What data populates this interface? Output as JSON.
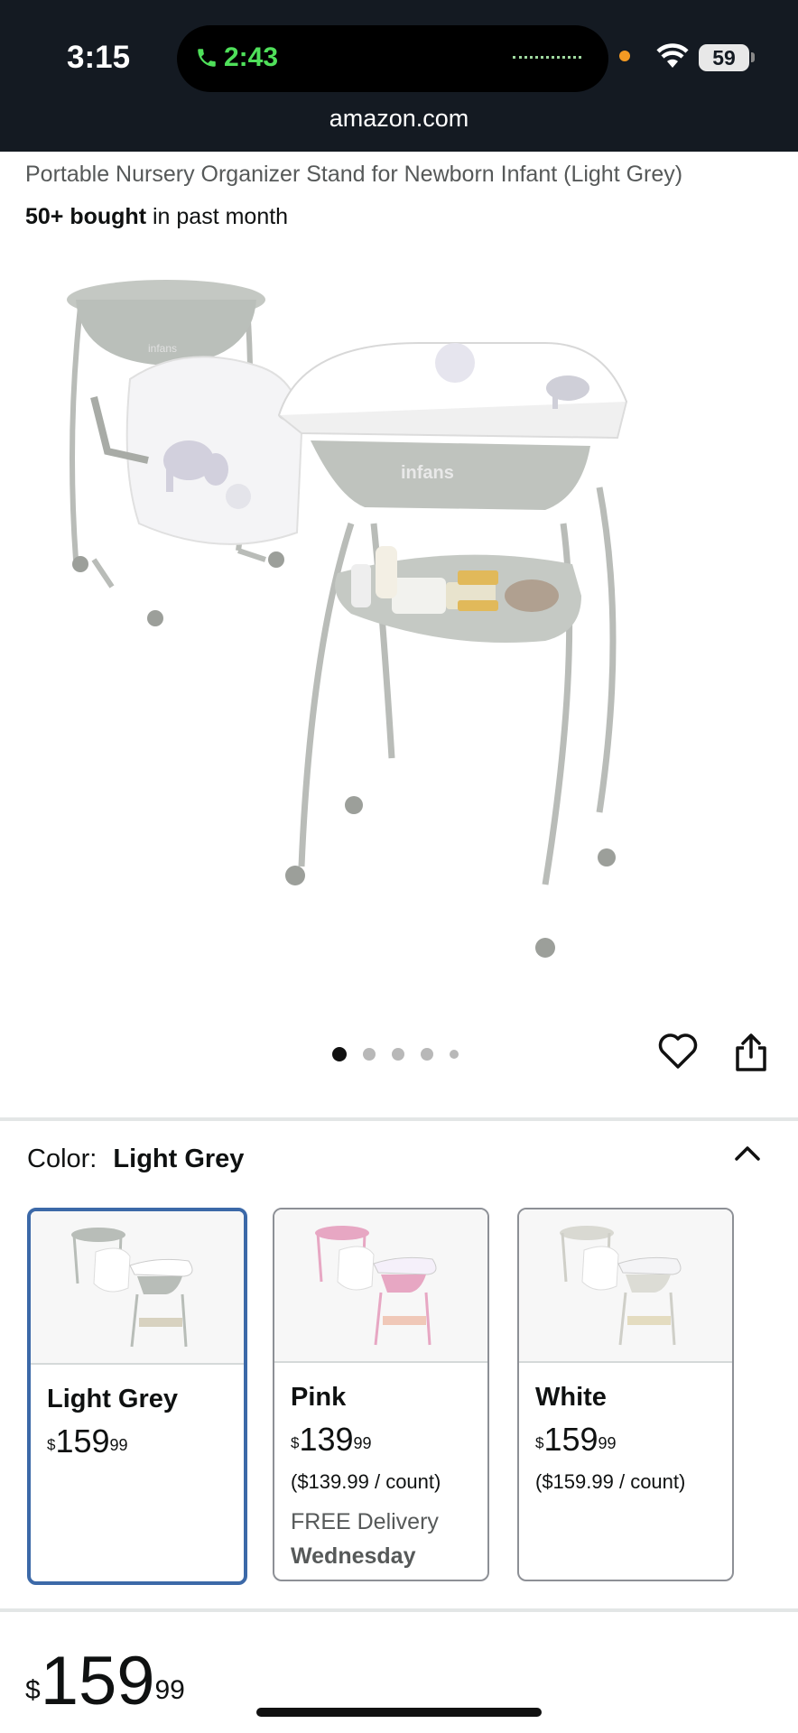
{
  "status_bar": {
    "time": "3:15",
    "call_time": "2:43",
    "battery": "59",
    "url": "amazon.com"
  },
  "product": {
    "title": "Portable Nursery Organizer Stand for Newborn Infant (Light Grey)",
    "bought_bold": "50+ bought",
    "bought_rest": " in past month",
    "image_brand_label": "infans",
    "image_count": 5,
    "active_image": 1
  },
  "color_selector": {
    "label": "Color:",
    "selected": "Light Grey",
    "options": [
      {
        "name": "Light Grey",
        "price_symbol": "$",
        "price_whole": "159",
        "price_cents": "99",
        "per_unit": "",
        "delivery_line1": "",
        "delivery_line2": "",
        "selected": true,
        "accent": "#b8bdb8"
      },
      {
        "name": "Pink",
        "price_symbol": "$",
        "price_whole": "139",
        "price_cents": "99",
        "per_unit": "($139.99 / count)",
        "delivery_line1": "FREE Delivery",
        "delivery_line2": "Wednesday",
        "selected": false,
        "accent": "#e7a7c3"
      },
      {
        "name": "White",
        "price_symbol": "$",
        "price_whole": "159",
        "price_cents": "99",
        "per_unit": "($159.99 / count)",
        "delivery_line1": "",
        "delivery_line2": "",
        "selected": false,
        "accent": "#d9d9d2"
      }
    ]
  },
  "price": {
    "symbol": "$",
    "whole": "159",
    "cents": "99"
  },
  "colors": {
    "status_bg": "#141a22",
    "selected_border": "#3c69a8",
    "call_green": "#4fe05a"
  }
}
